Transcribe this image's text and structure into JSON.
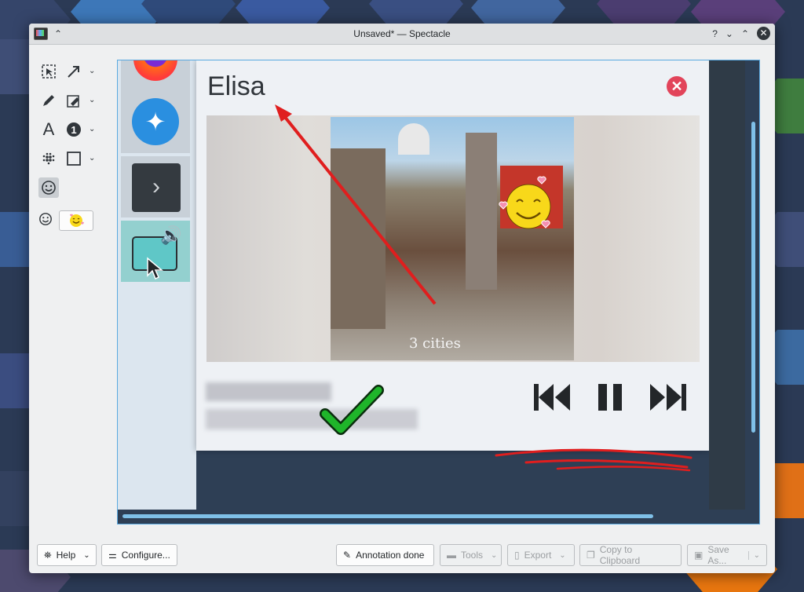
{
  "window": {
    "title": "Unsaved* — Spectacle",
    "help_glyph": "?",
    "minimize_glyph": "⌄",
    "maximize_glyph": "⌃",
    "close_glyph": "✕",
    "keep_above_glyph": "⌃"
  },
  "toolbar": {
    "tools": [
      {
        "name": "select-tool",
        "icon": "select-icon"
      },
      {
        "name": "arrow-tool",
        "icon": "arrow-icon"
      },
      {
        "name": "pen-tool",
        "icon": "pen-icon"
      },
      {
        "name": "highlighter-tool",
        "icon": "highlighter-icon"
      },
      {
        "name": "text-tool",
        "icon": "text-icon"
      },
      {
        "name": "number-tool",
        "icon": "number-icon"
      },
      {
        "name": "blur-tool",
        "icon": "blur-icon"
      },
      {
        "name": "rectangle-tool",
        "icon": "rectangle-icon"
      },
      {
        "name": "sticker-tool",
        "icon": "emoji-icon",
        "active": true
      }
    ]
  },
  "screenshot": {
    "popup_title": "Elisa",
    "album_text": "3 cities"
  },
  "buttons": {
    "help": "Help",
    "configure": "Configure...",
    "annotation_done": "Annotation done",
    "tools": "Tools",
    "export": "Export",
    "copy_clipboard": "Copy to Clipboard",
    "save_as": "Save As..."
  },
  "colors": {
    "accent": "#3daee9",
    "annotation_red": "#e01e1e",
    "check_green": "#1fb52a",
    "close_red": "#e2445a"
  }
}
